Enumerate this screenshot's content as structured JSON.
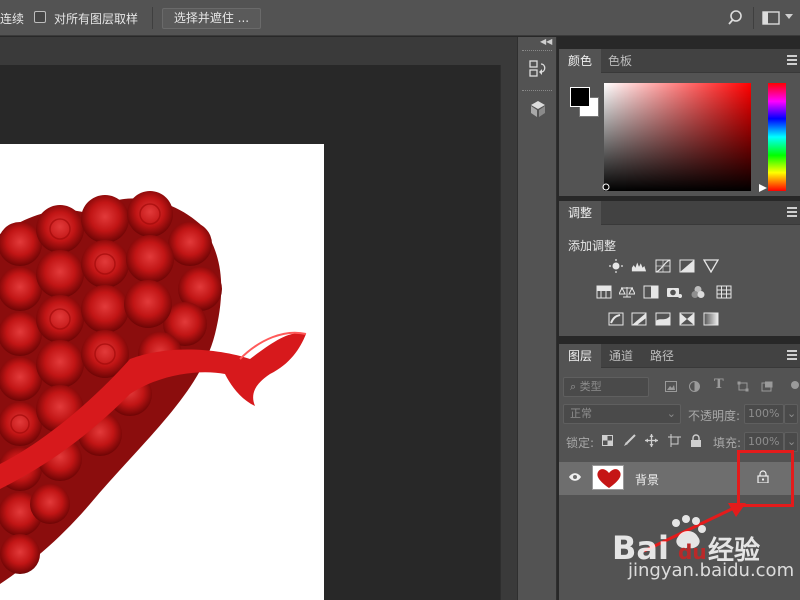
{
  "options_bar": {
    "contiguous_label": "连续",
    "sample_all_layers_label": "对所有图层取样",
    "sample_all_layers_checked": false,
    "select_and_mask_label": "选择并遮住 ..."
  },
  "icons": {
    "search": "search-icon",
    "workspace": "workspace-icon",
    "collapse": "double-chevron-icon"
  },
  "color_panel": {
    "tabs": [
      "颜色",
      "色板"
    ],
    "active_tab": 0,
    "foreground_color": "#000000",
    "background_color": "#ffffff",
    "hue_color": "#ff0000"
  },
  "adjustments_panel": {
    "tab": "调整",
    "add_label": "添加调整"
  },
  "layers_panel": {
    "tabs": [
      "图层",
      "通道",
      "路径"
    ],
    "active_tab": 0,
    "filter_kind": "类型",
    "blend_mode": "正常",
    "opacity_label": "不透明度:",
    "opacity_value": "100%",
    "lock_label": "锁定:",
    "fill_label": "填充:",
    "fill_value": "100%",
    "layers": [
      {
        "name": "背景",
        "visible": true,
        "locked": true
      }
    ]
  },
  "annotation": {
    "highlight_color": "#e41b1b"
  },
  "watermark": {
    "brand": "Bai du 经验",
    "url": "jingyan.baidu.com"
  }
}
